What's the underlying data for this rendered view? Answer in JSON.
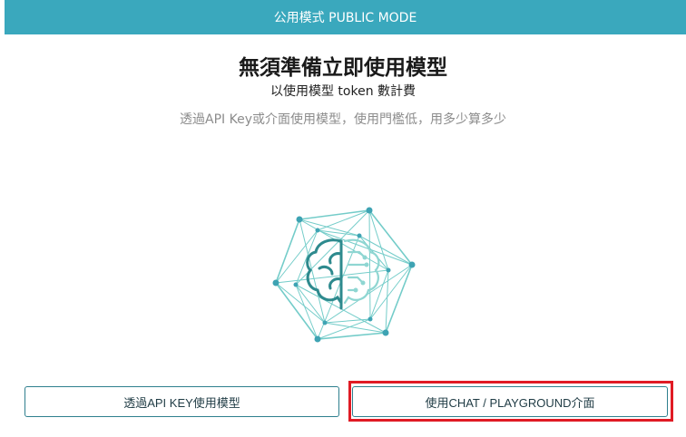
{
  "banner": {
    "label": "公用模式 PUBLIC MODE"
  },
  "hero": {
    "title": "無須準備立即使用模型",
    "subtitle": "以使用模型 token 數計費",
    "description": "透過API Key或介面使用模型，使用門檻低，用多少算多少"
  },
  "illustration": {
    "icon": "ai-brain-network-icon"
  },
  "actions": {
    "api_button_label": "透過API KEY使用模型",
    "chat_button_label": "使用CHAT / PLAYGROUND介面"
  },
  "colors": {
    "accent": "#3aa8bd",
    "brain_dark": "#2e8a8e",
    "highlight": "#e01b24"
  }
}
